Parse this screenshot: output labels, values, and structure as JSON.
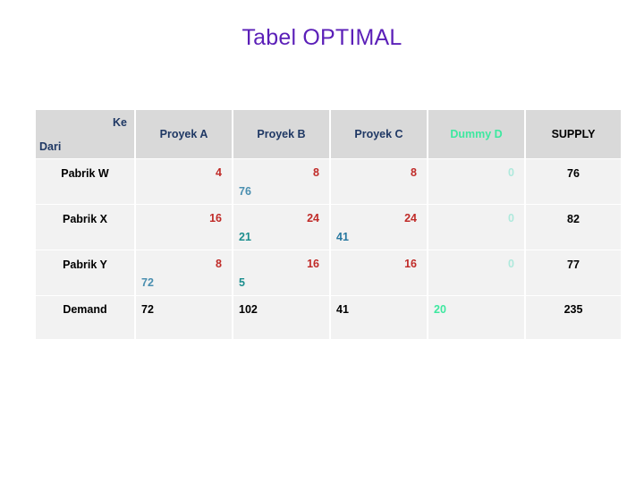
{
  "slide": {
    "title": "Tabel OPTIMAL"
  },
  "colors": {
    "title": "#5b1fb8",
    "header_text": "#1f3864",
    "dummy_accent": "#3EE8A0",
    "cost": "#C02B28",
    "cost_zero": "#AEE9DC",
    "alloc_blue": "#4A8FB0",
    "alloc_teal": "#1C8E8E",
    "header_bg": "#d9d9d9",
    "cell_bg": "#f2f2f2"
  },
  "table": {
    "corner": {
      "ke_label": "Ke",
      "dari_label": "Dari"
    },
    "columns": [
      {
        "label": "Proyek  A",
        "key": "A",
        "accent": false
      },
      {
        "label": "Proyek  B",
        "key": "B",
        "accent": false
      },
      {
        "label": "Proyek  C",
        "key": "C",
        "accent": false
      },
      {
        "label": "Dummy  D",
        "key": "D",
        "accent": true
      }
    ],
    "supply_header": "SUPPLY",
    "demand_label": "Demand",
    "rows": [
      {
        "label": "Pabrik  W",
        "cells": [
          {
            "cost": "4",
            "alloc": "",
            "alloc_color": "#4A8FB0"
          },
          {
            "cost": "8",
            "alloc": "76",
            "alloc_color": "#4A8FB0"
          },
          {
            "cost": "8",
            "alloc": "",
            "alloc_color": "#1C8E8E"
          },
          {
            "cost": "0",
            "alloc": "",
            "alloc_color": "#1C8E8E"
          }
        ],
        "supply": "76"
      },
      {
        "label": "Pabrik  X",
        "cells": [
          {
            "cost": "16",
            "alloc": "",
            "alloc_color": "#4A8FB0"
          },
          {
            "cost": "24",
            "alloc": "21",
            "alloc_color": "#1C8E8E"
          },
          {
            "cost": "24",
            "alloc": "41",
            "alloc_color": "#2878A0"
          },
          {
            "cost": "0",
            "alloc": "",
            "alloc_color": "#1C8E8E"
          }
        ],
        "supply": "82"
      },
      {
        "label": "Pabrik  Y",
        "cells": [
          {
            "cost": "8",
            "alloc": "72",
            "alloc_color": "#4A8FB0"
          },
          {
            "cost": "16",
            "alloc": "5",
            "alloc_color": "#1C8E8E"
          },
          {
            "cost": "16",
            "alloc": "",
            "alloc_color": "#1C8E8E"
          },
          {
            "cost": "0",
            "alloc": "",
            "alloc_color": "#1C8E8E"
          }
        ],
        "supply": "77"
      }
    ],
    "demand": {
      "values": [
        "72",
        "102",
        "41",
        "20"
      ],
      "total": "235"
    }
  }
}
